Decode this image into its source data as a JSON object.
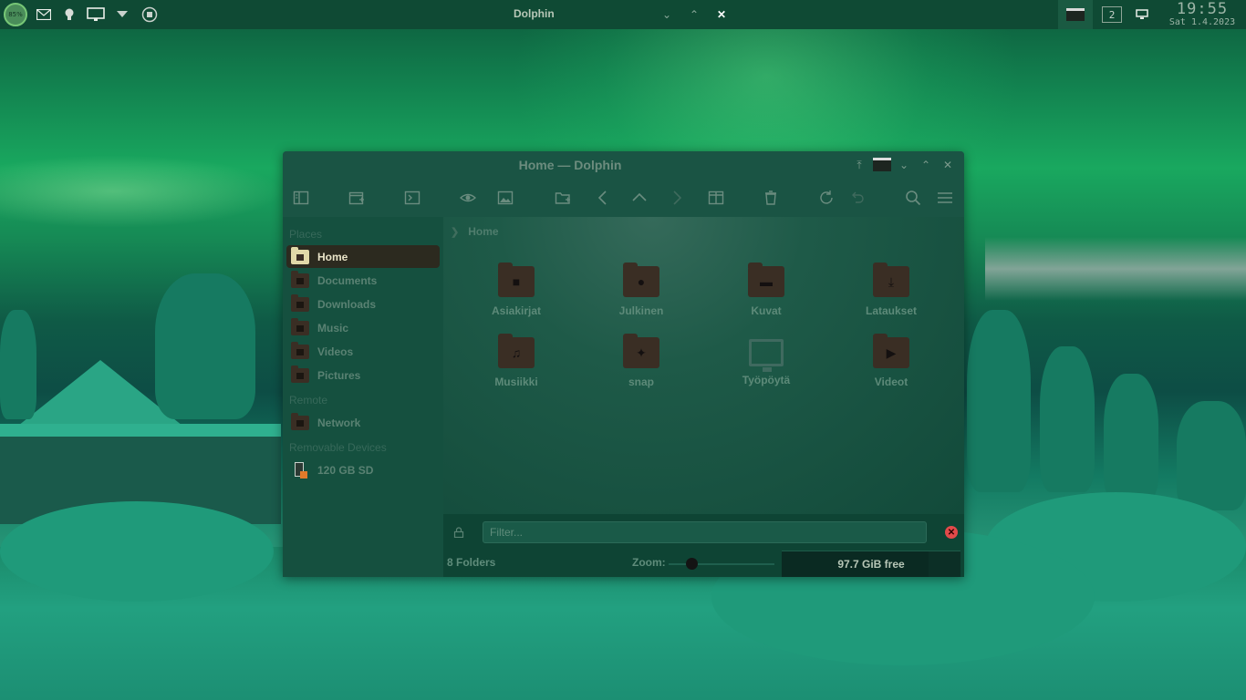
{
  "top_panel": {
    "battery_percent": "85%",
    "active_window_title": "Dolphin",
    "desktop_number": "2",
    "clock_time": "19:55",
    "clock_date": "Sat 1.4.2023"
  },
  "window": {
    "title": "Home — Dolphin"
  },
  "toolbar": {
    "icons": [
      "panels-icon",
      "new-window-icon",
      "terminal-icon",
      "preview-icon",
      "image-icon",
      "new-folder-icon",
      "back-icon",
      "up-icon",
      "forward-icon",
      "split-view-icon",
      "trash-icon",
      "reload-icon",
      "undo-icon",
      "search-icon",
      "menu-icon"
    ]
  },
  "sidebar": {
    "places_heading": "Places",
    "places": [
      {
        "label": "Home",
        "active": true
      },
      {
        "label": "Documents",
        "active": false
      },
      {
        "label": "Downloads",
        "active": false
      },
      {
        "label": "Music",
        "active": false
      },
      {
        "label": "Videos",
        "active": false
      },
      {
        "label": "Pictures",
        "active": false
      }
    ],
    "remote_heading": "Remote",
    "remote": [
      {
        "label": "Network"
      }
    ],
    "removable_heading": "Removable Devices",
    "removable": [
      {
        "label": "120 GB SD"
      }
    ]
  },
  "content": {
    "breadcrumb": "Home",
    "items": [
      {
        "name": "Asiakirjat",
        "icon": "document-folder-icon"
      },
      {
        "name": "Julkinen",
        "icon": "public-folder-icon"
      },
      {
        "name": "Kuvat",
        "icon": "pictures-folder-icon"
      },
      {
        "name": "Lataukset",
        "icon": "downloads-folder-icon"
      },
      {
        "name": "Musiikki",
        "icon": "music-folder-icon"
      },
      {
        "name": "snap",
        "icon": "snap-folder-icon"
      },
      {
        "name": "Työpöytä",
        "icon": "desktop-icon"
      },
      {
        "name": "Videot",
        "icon": "videos-folder-icon"
      }
    ]
  },
  "filter": {
    "placeholder": "Filter..."
  },
  "status": {
    "folders_count": "8 Folders",
    "zoom_label": "Zoom:",
    "free_space": "97.7 GiB free",
    "free_space_fraction": 0.82
  },
  "colors": {
    "accent": "#e1d9a8",
    "folder": "#3a2e24",
    "panel": "#0f4a34",
    "close_red": "#e14a4a"
  }
}
